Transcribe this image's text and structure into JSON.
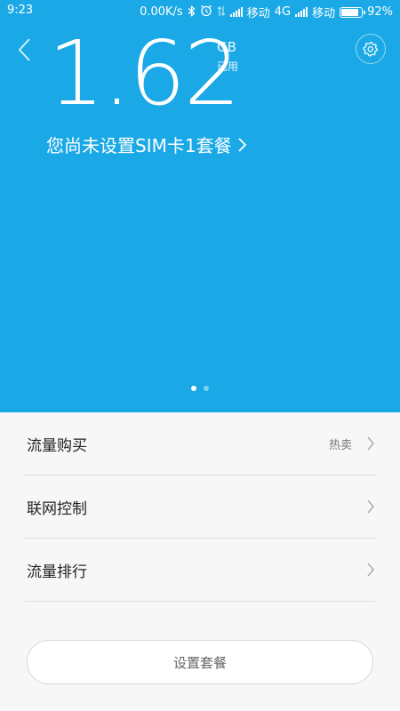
{
  "status_bar": {
    "time": "9:23",
    "net_speed": "0.00K/s",
    "carrier1": "移动",
    "network1": "4G",
    "carrier2": "移动",
    "battery_percent_label": "92%",
    "battery_level": 0.92
  },
  "header": {
    "back_icon": "chevron-left-icon",
    "settings_icon": "gear-icon"
  },
  "usage": {
    "value": "1.62",
    "unit": "GB",
    "caption": "已用"
  },
  "sim_notice": {
    "label": "您尚未设置SIM卡1套餐",
    "chevron": "›"
  },
  "pager": {
    "pages": 2,
    "active": 0
  },
  "menu": {
    "items": [
      {
        "label": "流量购买",
        "badge": "热卖"
      },
      {
        "label": "联网控制",
        "badge": ""
      },
      {
        "label": "流量排行",
        "badge": ""
      }
    ]
  },
  "actions": {
    "setup_plan_label": "设置套餐"
  },
  "colors": {
    "hero_bg": "#1aa9e6",
    "page_bg": "#f7f7f7"
  }
}
